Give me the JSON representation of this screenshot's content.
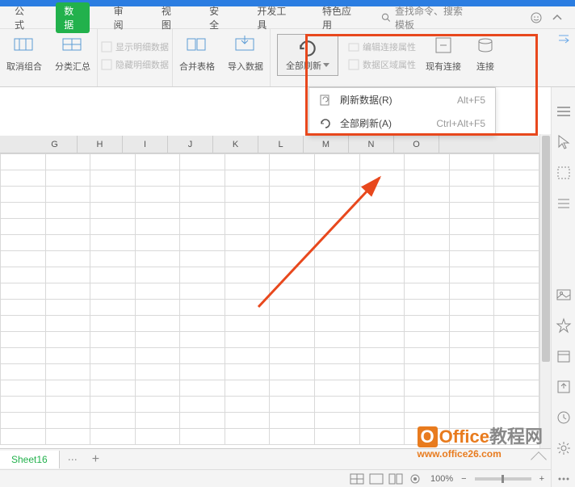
{
  "tabs": {
    "items": [
      "公式",
      "数据",
      "审阅",
      "视图",
      "安全",
      "开发工具",
      "特色应用"
    ],
    "active_index": 1,
    "search_placeholder": "查找命令、搜索模板"
  },
  "ribbon": {
    "ungroup": "取消组合",
    "subtotal": "分类汇总",
    "show_detail": "显示明细数据",
    "hide_detail": "隐藏明细数据",
    "merge": "合并表格",
    "import": "导入数据",
    "refresh_all": "全部刷新",
    "edit_conn": "编辑连接属性",
    "data_region": "数据区域属性",
    "existing_conn": "现有连接",
    "connect": "连接"
  },
  "dropdown": {
    "items": [
      {
        "icon": "refresh-page",
        "label": "刷新数据(R)",
        "shortcut": "Alt+F5"
      },
      {
        "icon": "refresh-circle",
        "label": "全部刷新(A)",
        "shortcut": "Ctrl+Alt+F5"
      }
    ]
  },
  "columns": [
    "G",
    "H",
    "I",
    "J",
    "K",
    "L",
    "M",
    "N",
    "O"
  ],
  "sheet": {
    "name": "Sheet16"
  },
  "status": {
    "zoom": "100%",
    "minus": "−",
    "plus": "+"
  },
  "watermark": {
    "brand": "Office",
    "suffix": "教程网",
    "url": "www.office26.com"
  }
}
